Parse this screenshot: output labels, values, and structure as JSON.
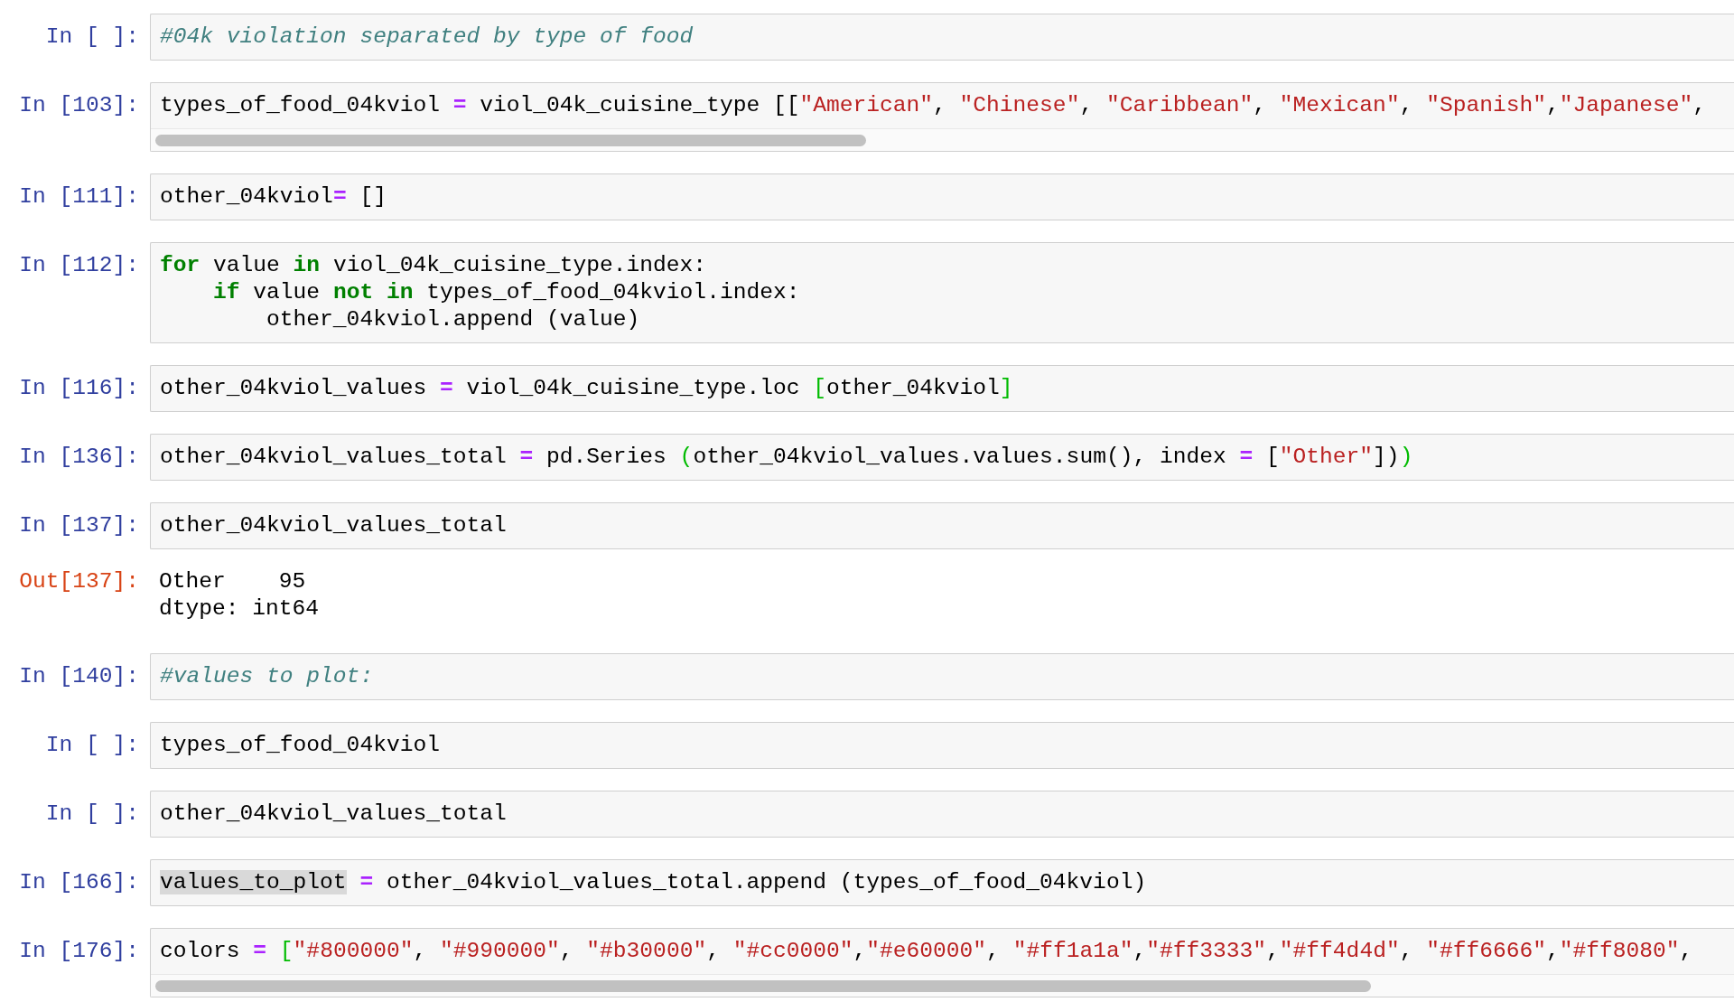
{
  "cells": [
    {
      "prompt": "In [ ]:",
      "scrollbar": false,
      "lines": [
        [
          {
            "text": "#04k violation separated by type of food",
            "kind": "comment"
          }
        ]
      ]
    },
    {
      "prompt": "In [103]:",
      "scrollbar": true,
      "lines": [
        [
          {
            "text": "types_of_food_04kviol ",
            "kind": "plain"
          },
          {
            "text": "=",
            "kind": "op"
          },
          {
            "text": " viol_04k_cuisine_type [[",
            "kind": "plain"
          },
          {
            "text": "\"American\"",
            "kind": "str"
          },
          {
            "text": ", ",
            "kind": "plain"
          },
          {
            "text": "\"Chinese\"",
            "kind": "str"
          },
          {
            "text": ", ",
            "kind": "plain"
          },
          {
            "text": "\"Caribbean\"",
            "kind": "str"
          },
          {
            "text": ", ",
            "kind": "plain"
          },
          {
            "text": "\"Mexican\"",
            "kind": "str"
          },
          {
            "text": ", ",
            "kind": "plain"
          },
          {
            "text": "\"Spanish\"",
            "kind": "str"
          },
          {
            "text": ",",
            "kind": "plain"
          },
          {
            "text": "\"Japanese\"",
            "kind": "str"
          },
          {
            "text": ",",
            "kind": "plain"
          }
        ]
      ]
    },
    {
      "prompt": "In [111]:",
      "scrollbar": false,
      "lines": [
        [
          {
            "text": "other_04kviol",
            "kind": "plain"
          },
          {
            "text": "=",
            "kind": "op"
          },
          {
            "text": " []",
            "kind": "plain"
          }
        ]
      ]
    },
    {
      "prompt": "In [112]:",
      "scrollbar": false,
      "lines": [
        [
          {
            "text": "for",
            "kind": "kw"
          },
          {
            "text": " value ",
            "kind": "plain"
          },
          {
            "text": "in",
            "kind": "kw"
          },
          {
            "text": " viol_04k_cuisine_type.index:",
            "kind": "plain"
          }
        ],
        [
          {
            "text": "    if",
            "kind": "kw"
          },
          {
            "text": " value ",
            "kind": "plain"
          },
          {
            "text": "not in",
            "kind": "kw"
          },
          {
            "text": " types_of_food_04kviol.index:",
            "kind": "plain"
          }
        ],
        [
          {
            "text": "        other_04kviol.append (value)",
            "kind": "plain"
          }
        ]
      ]
    },
    {
      "prompt": "In [116]:",
      "scrollbar": false,
      "lines": [
        [
          {
            "text": "other_04kviol_values ",
            "kind": "plain"
          },
          {
            "text": "=",
            "kind": "op"
          },
          {
            "text": " viol_04k_cuisine_type.loc ",
            "kind": "plain"
          },
          {
            "text": "[",
            "kind": "match"
          },
          {
            "text": "other_04kviol",
            "kind": "plain"
          },
          {
            "text": "]",
            "kind": "match"
          }
        ]
      ]
    },
    {
      "prompt": "In [136]:",
      "scrollbar": false,
      "lines": [
        [
          {
            "text": "other_04kviol_values_total ",
            "kind": "plain"
          },
          {
            "text": "=",
            "kind": "op"
          },
          {
            "text": " pd.Series ",
            "kind": "plain"
          },
          {
            "text": "(",
            "kind": "match"
          },
          {
            "text": "other_04kviol_values.values.sum(), index ",
            "kind": "plain"
          },
          {
            "text": "=",
            "kind": "op"
          },
          {
            "text": " [",
            "kind": "plain"
          },
          {
            "text": "\"Other\"",
            "kind": "str"
          },
          {
            "text": "])",
            "kind": "plain"
          },
          {
            "text": ")",
            "kind": "match"
          }
        ]
      ]
    },
    {
      "prompt": "In [137]:",
      "scrollbar": false,
      "lines": [
        [
          {
            "text": "other_04kviol_values_total",
            "kind": "plain"
          }
        ]
      ],
      "output": {
        "prompt": "Out[137]:",
        "lines": [
          "Other    95",
          "dtype: int64"
        ]
      }
    },
    {
      "prompt": "In [140]:",
      "scrollbar": false,
      "lines": [
        [
          {
            "text": "#values to plot:",
            "kind": "comment"
          }
        ]
      ]
    },
    {
      "prompt": "In [ ]:",
      "scrollbar": false,
      "lines": [
        [
          {
            "text": "types_of_food_04kviol",
            "kind": "plain"
          }
        ]
      ]
    },
    {
      "prompt": "In [ ]:",
      "scrollbar": false,
      "lines": [
        [
          {
            "text": "other_04kviol_values_total",
            "kind": "plain"
          }
        ]
      ]
    },
    {
      "prompt": "In [166]:",
      "scrollbar": false,
      "lines": [
        [
          {
            "text": "values_to_plot",
            "kind": "selection"
          },
          {
            "text": " =",
            "kind": "op"
          },
          {
            "text": " other_04kviol_values_total.append (types_of_food_04kviol)",
            "kind": "plain"
          }
        ]
      ]
    },
    {
      "prompt": "In [176]:",
      "scrollbar": true,
      "lines": [
        [
          {
            "text": "colors ",
            "kind": "plain"
          },
          {
            "text": "= ",
            "kind": "op"
          },
          {
            "text": "[",
            "kind": "match"
          },
          {
            "text": "\"#800000\"",
            "kind": "str"
          },
          {
            "text": ", ",
            "kind": "plain"
          },
          {
            "text": "\"#990000\"",
            "kind": "str"
          },
          {
            "text": ", ",
            "kind": "plain"
          },
          {
            "text": "\"#b30000\"",
            "kind": "str"
          },
          {
            "text": ", ",
            "kind": "plain"
          },
          {
            "text": "\"#cc0000\"",
            "kind": "str"
          },
          {
            "text": ",",
            "kind": "plain"
          },
          {
            "text": "\"#e60000\"",
            "kind": "str"
          },
          {
            "text": ", ",
            "kind": "plain"
          },
          {
            "text": "\"#ff1a1a\"",
            "kind": "str"
          },
          {
            "text": ",",
            "kind": "plain"
          },
          {
            "text": "\"#ff3333\"",
            "kind": "str"
          },
          {
            "text": ",",
            "kind": "plain"
          },
          {
            "text": "\"#ff4d4d\"",
            "kind": "str"
          },
          {
            "text": ", ",
            "kind": "plain"
          },
          {
            "text": "\"#ff6666\"",
            "kind": "str"
          },
          {
            "text": ",",
            "kind": "plain"
          },
          {
            "text": "\"#ff8080\"",
            "kind": "str"
          },
          {
            "text": ",",
            "kind": "plain"
          }
        ]
      ]
    }
  ]
}
